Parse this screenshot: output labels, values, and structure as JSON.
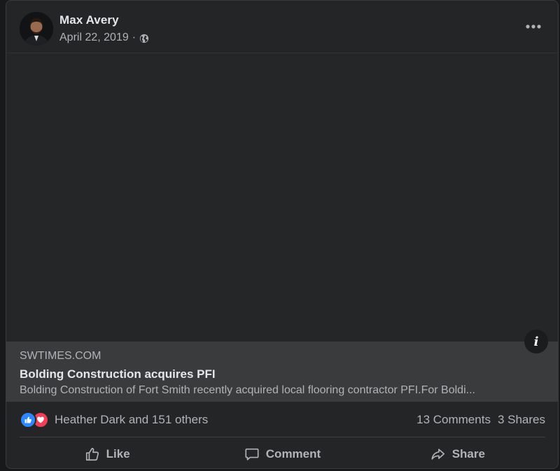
{
  "post": {
    "author": "Max Avery",
    "date": "April 22, 2019",
    "separator": "·",
    "privacy_icon": "globe-icon",
    "more_icon": "more-horizontal-icon"
  },
  "link": {
    "domain": "SWTIMES.COM",
    "title": "Bolding Construction acquires PFI",
    "description": "Bolding Construction of Fort Smith recently acquired local flooring contractor PFI.For Boldi...",
    "info_label": "i"
  },
  "stats": {
    "reaction_icons": [
      "like-reaction-icon",
      "love-reaction-icon"
    ],
    "reactors": "Heather Dark and 151 others",
    "comments": "13 Comments",
    "shares": "3 Shares"
  },
  "actions": [
    {
      "label": "Like",
      "icon": "thumbs-up-icon"
    },
    {
      "label": "Comment",
      "icon": "comment-bubble-icon"
    },
    {
      "label": "Share",
      "icon": "share-arrow-icon"
    }
  ],
  "colors": {
    "card_background": "#242526",
    "link_background": "#3a3b3c",
    "primary_text": "#e4e6eb",
    "secondary_text": "#b0b3b8",
    "like_blue": "#2d88ff",
    "love_red": "#f33e58"
  }
}
